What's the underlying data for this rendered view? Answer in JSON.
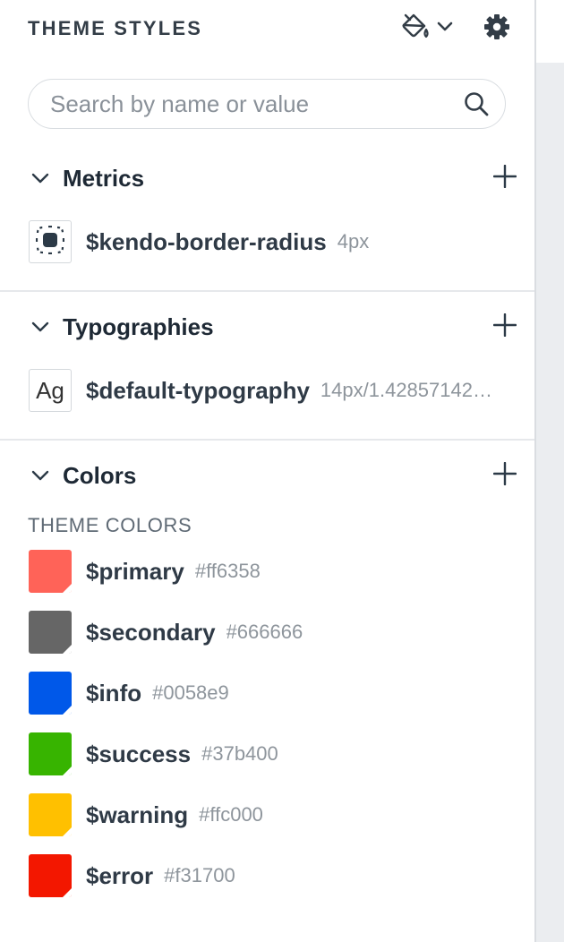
{
  "header": {
    "title": "THEME STYLES"
  },
  "search": {
    "placeholder": "Search by name or value",
    "value": ""
  },
  "sections": {
    "metrics": {
      "title": "Metrics",
      "items": [
        {
          "name": "$kendo-border-radius",
          "value": "4px"
        }
      ]
    },
    "typographies": {
      "title": "Typographies",
      "items": [
        {
          "name": "$default-typography",
          "value": "14px/1.42857142…",
          "thumb": "Ag"
        }
      ]
    },
    "colors": {
      "title": "Colors",
      "group_label": "THEME COLORS",
      "items": [
        {
          "name": "$primary",
          "value": "#ff6358",
          "color": "#ff6358"
        },
        {
          "name": "$secondary",
          "value": "#666666",
          "color": "#666666"
        },
        {
          "name": "$info",
          "value": "#0058e9",
          "color": "#0058e9"
        },
        {
          "name": "$success",
          "value": "#37b400",
          "color": "#37b400"
        },
        {
          "name": "$warning",
          "value": "#ffc000",
          "color": "#ffc000"
        },
        {
          "name": "$error",
          "value": "#f31700",
          "color": "#f31700"
        }
      ]
    }
  },
  "icons": {
    "paint": "paint-bucket-icon",
    "dropdown": "chevron-down-icon",
    "settings": "gear-icon",
    "search": "search-icon",
    "collapse": "chevron-down-icon",
    "add": "plus-icon"
  }
}
